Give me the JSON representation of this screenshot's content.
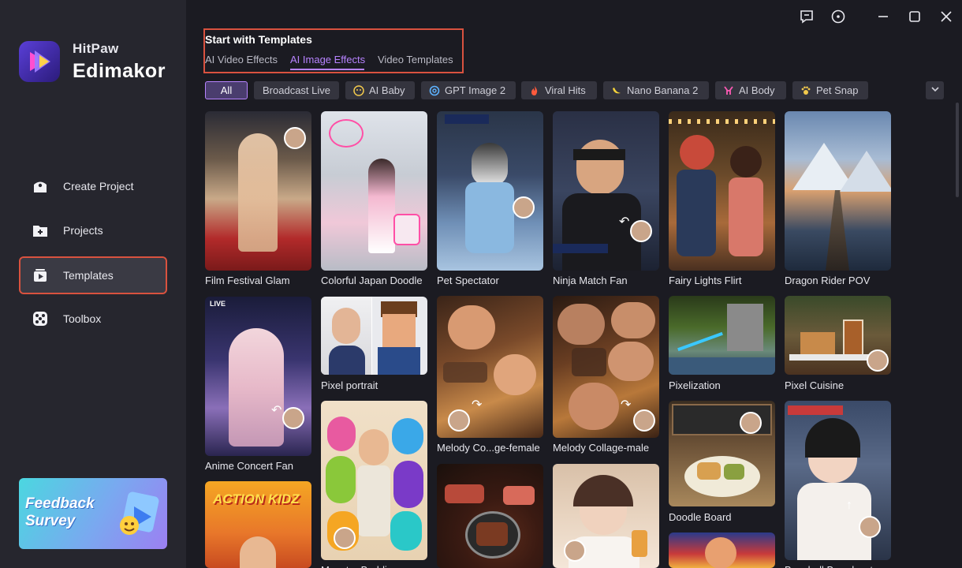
{
  "brand": {
    "small": "HitPaw",
    "big": "Edimakor"
  },
  "nav": [
    {
      "label": "Create Project",
      "icon": "create-project-icon"
    },
    {
      "label": "Projects",
      "icon": "projects-icon"
    },
    {
      "label": "Templates",
      "icon": "templates-icon"
    },
    {
      "label": "Toolbox",
      "icon": "toolbox-icon"
    }
  ],
  "feedback": {
    "line1": "Feedback",
    "line2": "Survey"
  },
  "header": {
    "title": "Start with Templates"
  },
  "tabs": [
    "AI Video Effects",
    "AI Image Effects",
    "Video Templates"
  ],
  "chips": [
    "All",
    "Broadcast Live",
    "AI Baby",
    "GPT Image 2",
    "Viral Hits",
    "Nano Banana 2",
    "AI Body",
    "Pet Snap"
  ],
  "cards": [
    "Film Festival Glam",
    "Colorful Japan Doodle",
    "Pet Spectator",
    "Ninja Match Fan",
    "Fairy Lights Flirt",
    "Dragon Rider POV",
    "Anime Concert Fan",
    "Pixel portrait",
    "Melody Co...ge-female",
    "Melody Collage-male",
    "Pixelization",
    "Pixel Cuisine",
    "Doodle Board",
    "Monster Buddies",
    "Baseball Broadcast"
  ],
  "thumb_text": {
    "action_kidz": "ACTION KIDZ",
    "live": "LIVE"
  },
  "colors": {
    "accent": "#b783ff",
    "highlight": "#d9523f",
    "sidebar": "#26262e",
    "bg": "#1b1b22"
  }
}
